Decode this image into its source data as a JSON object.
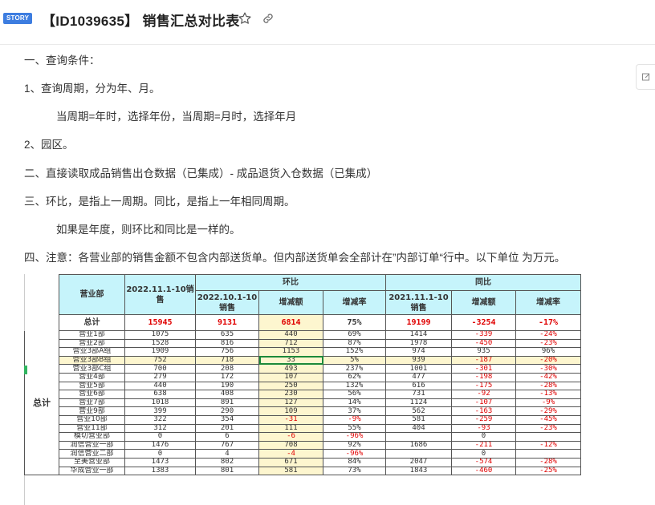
{
  "header": {
    "badge": "STORY",
    "title": "【ID1039635】 销售汇总对比表",
    "icons": {
      "star": "star-icon",
      "link": "link-icon",
      "side": "edit-icon"
    }
  },
  "doc": {
    "lines": [
      "一、查询条件：",
      "1、查询周期，分为年、月。",
      "当周期=年时，选择年份，当周期=月时，选择年月",
      "2、园区。",
      "二、直接读取成品销售出仓数据（已集成）- 成品退货入仓数据（已集成）",
      "三、环比，是指上一周期。同比，是指上一年相同周期。",
      "如果是年度，则环比和同比是一样的。",
      "四、注意：各营业部的销售金额不包含内部送货单。但内部送货单会全部计在”内部订单“行中。以下单位 为万元。"
    ]
  },
  "table": {
    "h_dept": "营业部",
    "h_sales": "2022.11.1-10销售",
    "h_mom": "环比",
    "h_yoy": "同比",
    "h_mom_sales": "2022.10.1-10销售",
    "h_mom_inc": "增减额",
    "h_mom_rate": "增减率",
    "h_yoy_sales": "2021.11.1-10销售",
    "h_yoy_inc": "增减额",
    "h_yoy_rate": "增减率",
    "total_label": "总计",
    "group_label": "总计",
    "total": [
      "15945",
      "9131",
      "6814",
      "75%",
      "19199",
      "-3254",
      "-17%"
    ],
    "rows": [
      [
        "营业1部",
        "1075",
        "635",
        "440",
        "69%",
        "1414",
        "-339",
        "-24%"
      ],
      [
        "营业2部",
        "1528",
        "816",
        "712",
        "87%",
        "1978",
        "-450",
        "-23%"
      ],
      [
        "营业3部A组",
        "1909",
        "756",
        "1153",
        "152%",
        "974",
        "935",
        "96%"
      ],
      [
        "营业3部B组",
        "752",
        "718",
        "33",
        "5%",
        "939",
        "-187",
        "-20%"
      ],
      [
        "营业3部C组",
        "700",
        "208",
        "493",
        "237%",
        "1001",
        "-301",
        "-30%"
      ],
      [
        "营业4部",
        "279",
        "172",
        "107",
        "62%",
        "477",
        "-198",
        "-42%"
      ],
      [
        "营业5部",
        "440",
        "190",
        "250",
        "132%",
        "616",
        "-175",
        "-28%"
      ],
      [
        "营业6部",
        "638",
        "408",
        "230",
        "56%",
        "731",
        "-92",
        "-13%"
      ],
      [
        "营业7部",
        "1018",
        "891",
        "127",
        "14%",
        "1124",
        "-107",
        "-9%"
      ],
      [
        "营业9部",
        "399",
        "290",
        "109",
        "37%",
        "562",
        "-163",
        "-29%"
      ],
      [
        "营业10部",
        "322",
        "354",
        "-31",
        "-9%",
        "581",
        "-259",
        "-45%"
      ],
      [
        "营业11部",
        "312",
        "201",
        "111",
        "55%",
        "404",
        "-93",
        "-23%"
      ],
      [
        "模切营业部",
        "0",
        "6",
        "-6",
        "-96%",
        "",
        "0",
        ""
      ],
      [
        "润信营业一部",
        "1476",
        "767",
        "708",
        "92%",
        "1686",
        "-211",
        "-12%"
      ],
      [
        "润信营业二部",
        "0",
        "4",
        "-4",
        "-96%",
        "",
        "0",
        ""
      ],
      [
        "至美营业部",
        "1473",
        "802",
        "671",
        "84%",
        "2047",
        "-574",
        "-28%"
      ],
      [
        "华成营业一部",
        "1383",
        "801",
        "581",
        "73%",
        "1843",
        "-460",
        "-25%"
      ]
    ]
  }
}
